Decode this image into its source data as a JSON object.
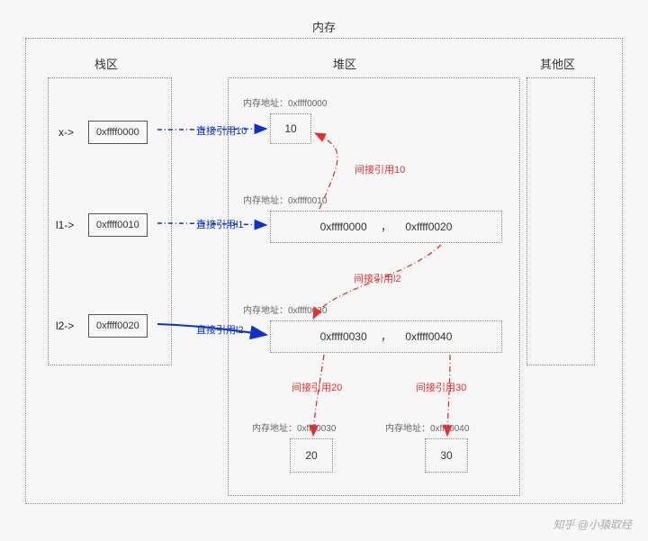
{
  "title": "内存",
  "sections": {
    "stack": "栈区",
    "heap": "堆区",
    "other": "其他区"
  },
  "stack": {
    "x": {
      "label": "x->",
      "addr": "0xffff0000"
    },
    "l1": {
      "label": "l1->",
      "addr": "0xffff0010"
    },
    "l2": {
      "label": "l2->",
      "addr": "0xffff0020"
    }
  },
  "heap": {
    "obj10": {
      "addrlabel": "内存地址：0xffff0000",
      "value": "10"
    },
    "l1list": {
      "addrlabel": "内存地址：0xffff0010",
      "e0": "0xffff0000",
      "comma": "，",
      "e1": "0xffff0020"
    },
    "l2list": {
      "addrlabel": "内存地址：0xffff0020",
      "e0": "0xffff0030",
      "comma": "，",
      "e1": "0xffff0040"
    },
    "obj20": {
      "addrlabel": "内存地址：0xffff0030",
      "value": "20"
    },
    "obj30": {
      "addrlabel": "内存地址：0xffff0040",
      "value": "30"
    }
  },
  "edges": {
    "direct10": "直接引用10",
    "directl1": "直接引用l1",
    "directl2": "直接引用l2",
    "indirect10": "间接引用10",
    "indirectl2": "间接引用l2",
    "indirect20": "间接引用20",
    "indirect30": "间接引用30"
  },
  "watermark": "知乎 @小猿取经"
}
